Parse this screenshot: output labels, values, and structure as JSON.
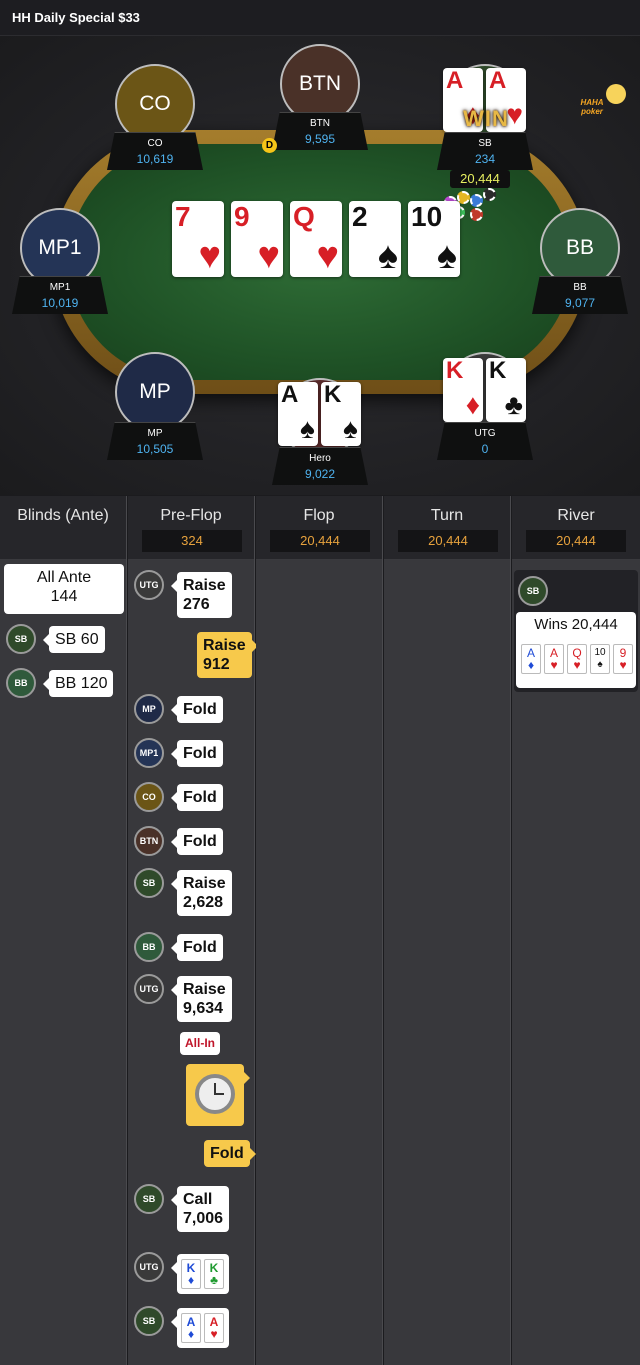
{
  "header": {
    "title": "HH  Daily Special $33"
  },
  "table": {
    "logo": "HAHA poker",
    "seats": {
      "co": {
        "label": "CO",
        "name": "CO",
        "stack": "10,619",
        "color": "#6b5516"
      },
      "btn": {
        "label": "BTN",
        "name": "BTN",
        "stack": "9,595",
        "color": "#4a3128"
      },
      "sb": {
        "name": "SB",
        "stack": "234"
      },
      "mp1": {
        "label": "MP1",
        "name": "MP1",
        "stack": "10,019",
        "color": "#243456"
      },
      "bb": {
        "label": "BB",
        "name": "BB",
        "stack": "9,077",
        "color": "#2f5a3b"
      },
      "mp": {
        "label": "MP",
        "name": "MP",
        "stack": "10,505",
        "color": "#1f2a47"
      },
      "hero": {
        "name": "Hero",
        "stack": "9,022"
      },
      "utg": {
        "name": "UTG",
        "stack": "0"
      }
    },
    "dealer": "D",
    "win_text": "WIN",
    "pot": "20,444",
    "board": [
      {
        "rank": "7",
        "suit": "♥",
        "color": "red"
      },
      {
        "rank": "9",
        "suit": "♥",
        "color": "red"
      },
      {
        "rank": "Q",
        "suit": "♥",
        "color": "red"
      },
      {
        "rank": "2",
        "suit": "♠",
        "color": "blk"
      },
      {
        "rank": "10",
        "suit": "♠",
        "color": "blk"
      }
    ],
    "sb_cards": [
      {
        "rank": "A",
        "suit": "♦"
      },
      {
        "rank": "A",
        "suit": "♥"
      }
    ],
    "hero_cards": [
      {
        "rank": "A",
        "suit": "♠"
      },
      {
        "rank": "K",
        "suit": "♠"
      }
    ],
    "utg_cards": [
      {
        "rank": "K",
        "suit": "♦"
      },
      {
        "rank": "K",
        "suit": "♣"
      }
    ]
  },
  "streets": {
    "blinds": {
      "title": "Blinds (Ante)"
    },
    "preflop": {
      "title": "Pre-Flop",
      "pot": "324"
    },
    "flop": {
      "title": "Flop",
      "pot": "20,444"
    },
    "turn": {
      "title": "Turn",
      "pot": "20,444"
    },
    "river": {
      "title": "River",
      "pot": "20,444"
    }
  },
  "blinds_actions": {
    "ante_label": "All Ante",
    "ante_value": "144",
    "sb_tag": "SB",
    "sb_text": "SB  60",
    "bb_tag": "BB",
    "bb_text": "BB  120"
  },
  "preflop_actions": {
    "a1_tag": "UTG",
    "a1_action": "Raise",
    "a1_amount": "276",
    "a2_action": "Raise",
    "a2_amount": "912",
    "a3_tag": "MP",
    "a3_action": "Fold",
    "a4_tag": "MP1",
    "a4_action": "Fold",
    "a5_tag": "CO",
    "a5_action": "Fold",
    "a6_tag": "BTN",
    "a6_action": "Fold",
    "a7_tag": "SB",
    "a7_action": "Raise",
    "a7_amount": "2,628",
    "a8_tag": "BB",
    "a8_action": "Fold",
    "a9_tag": "UTG",
    "a9_action": "Raise",
    "a9_amount": "9,634",
    "a9_badge": "All-In",
    "a10_action": "Fold",
    "a11_tag": "SB",
    "a11_action": "Call",
    "a11_amount": "7,006",
    "a12_tag": "UTG",
    "a13_tag": "SB",
    "utg_show": [
      {
        "rank": "K",
        "suit": "♦"
      },
      {
        "rank": "K",
        "suit": "♣"
      }
    ],
    "sb_show": [
      {
        "rank": "A",
        "suit": "♦"
      },
      {
        "rank": "A",
        "suit": "♥"
      }
    ]
  },
  "river_result": {
    "tag": "SB",
    "text": "Wins 20,444",
    "cards": [
      {
        "rank": "A",
        "suit": "♦"
      },
      {
        "rank": "A",
        "suit": "♥"
      },
      {
        "rank": "Q",
        "suit": "♥"
      },
      {
        "rank": "10",
        "suit": "♠"
      },
      {
        "rank": "9",
        "suit": "♥"
      }
    ]
  }
}
